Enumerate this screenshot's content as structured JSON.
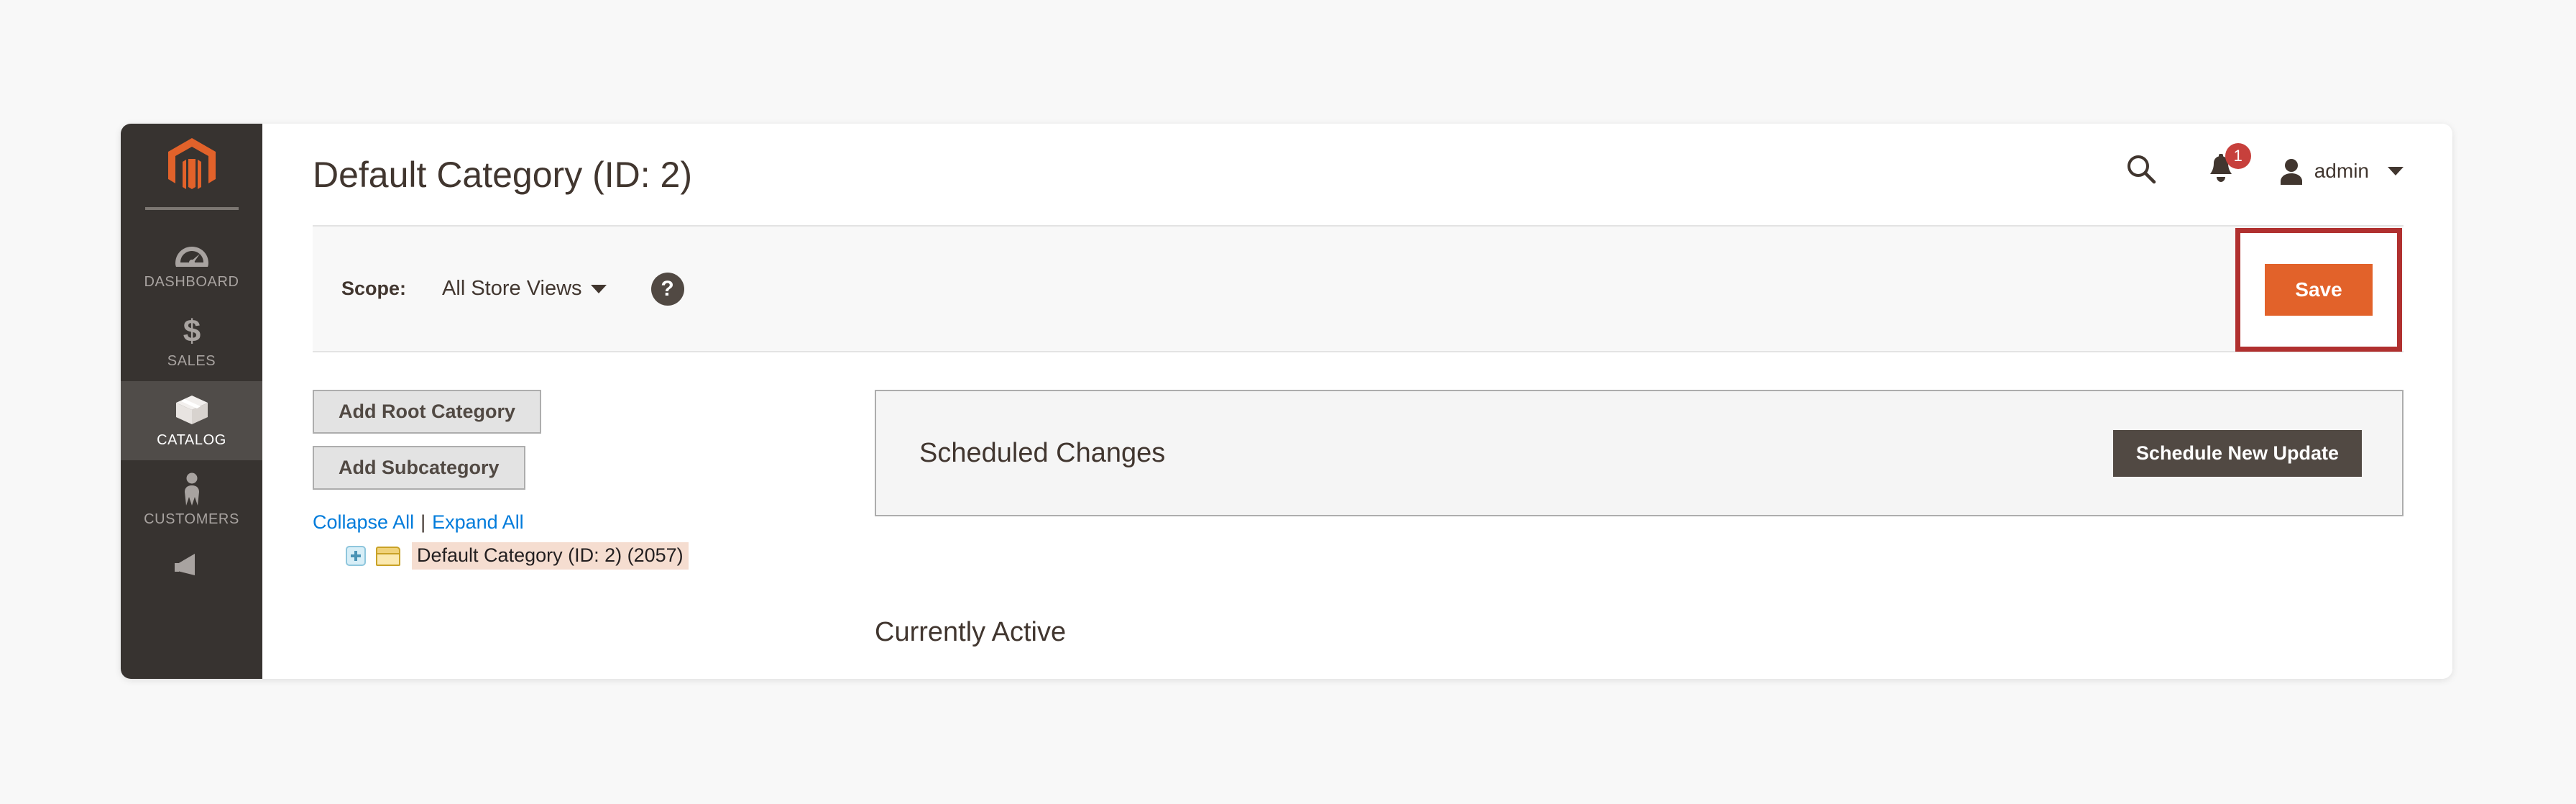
{
  "sidebar": {
    "logo_icon": "magento-logo-icon",
    "items": [
      {
        "label": "DASHBOARD",
        "icon": "dashboard-gauge-icon",
        "active": false
      },
      {
        "label": "SALES",
        "icon": "dollar-sign-icon",
        "active": false
      },
      {
        "label": "CATALOG",
        "icon": "box-package-icon",
        "active": true
      },
      {
        "label": "CUSTOMERS",
        "icon": "person-icon",
        "active": false
      }
    ]
  },
  "header": {
    "title": "Default Category (ID: 2)",
    "search_icon": "search-icon",
    "notification_icon": "bell-icon",
    "notification_count": "1",
    "user_icon": "user-avatar-icon",
    "user_name": "admin",
    "caret_icon": "chevron-down-icon"
  },
  "scope": {
    "label": "Scope:",
    "selected_value": "All Store Views",
    "caret_icon": "chevron-down-icon",
    "help_icon": "question-mark-icon",
    "help_glyph": "?",
    "save_label": "Save",
    "save_color": "#e2622a",
    "highlight_color": "#b0302f"
  },
  "tree": {
    "add_root_label": "Add Root Category",
    "add_sub_label": "Add Subcategory",
    "collapse_all_label": "Collapse All",
    "separator": "|",
    "expand_all_label": "Expand All",
    "nodes": [
      {
        "label": "Default Category (ID: 2) (2057)",
        "expander_icon": "plus-expand-icon",
        "folder_icon": "folder-icon",
        "highlight_color": "#f5ddd0"
      }
    ]
  },
  "scheduled": {
    "panel_title": "Scheduled Changes",
    "button_label": "Schedule New Update",
    "button_color": "#514943"
  },
  "main": {
    "currently_active_label": "Currently Active"
  }
}
